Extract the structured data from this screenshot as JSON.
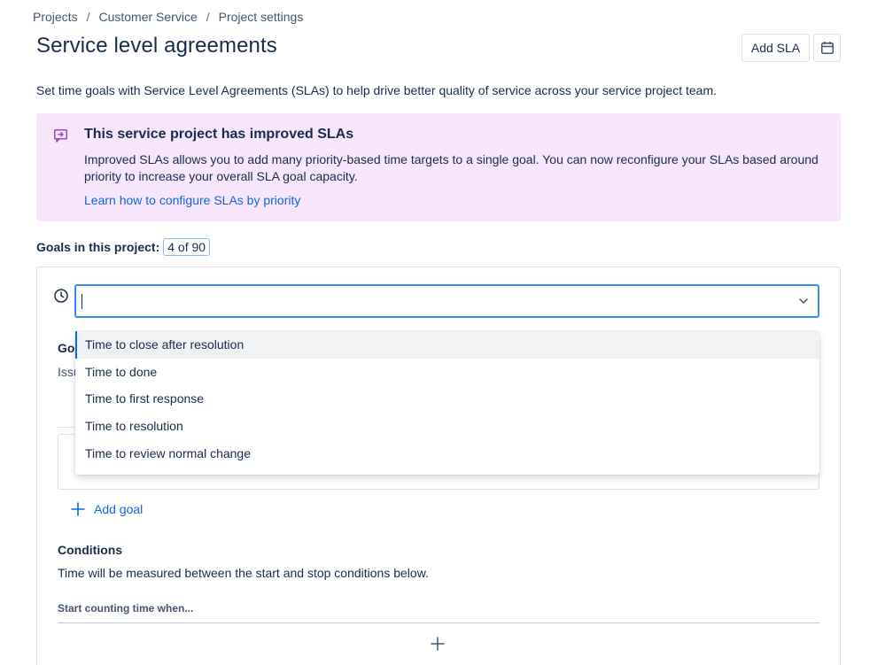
{
  "breadcrumb": {
    "items": [
      "Projects",
      "Customer Service",
      "Project settings"
    ],
    "separator": "/"
  },
  "page": {
    "title": "Service level agreements",
    "description": "Set time goals with Service Level Agreements (SLAs) to help drive better quality of service across your service project team."
  },
  "toolbar": {
    "add_sla_label": "Add SLA",
    "calendar_icon": "calendar-icon"
  },
  "banner": {
    "icon": "feedback-icon",
    "title": "This service project has improved SLAs",
    "body": "Improved SLAs allows you to add many priority-based time targets to a single goal. You can now reconfigure your SLAs based around priority to increase your overall SLA goal capacity.",
    "link": "Learn how to configure SLAs by priority",
    "accent_color": "#f8e6fc"
  },
  "goals": {
    "label": "Goals in this project:",
    "count": "4 of 90"
  },
  "sla_select": {
    "value": "",
    "options": [
      "Time to close after resolution",
      "Time to done",
      "Time to first response",
      "Time to resolution",
      "Time to review normal change"
    ],
    "highlighted_index": 0
  },
  "partial": {
    "goal_heading": "Go",
    "issue_text": "Issu"
  },
  "add_goal": {
    "label": "Add goal"
  },
  "conditions": {
    "title": "Conditions",
    "description": "Time will be measured between the start and stop conditions below.",
    "start_label": "Start counting time when..."
  },
  "colors": {
    "link": "#0c66e4",
    "focus_border": "#388bff",
    "text": "#172b4d"
  }
}
